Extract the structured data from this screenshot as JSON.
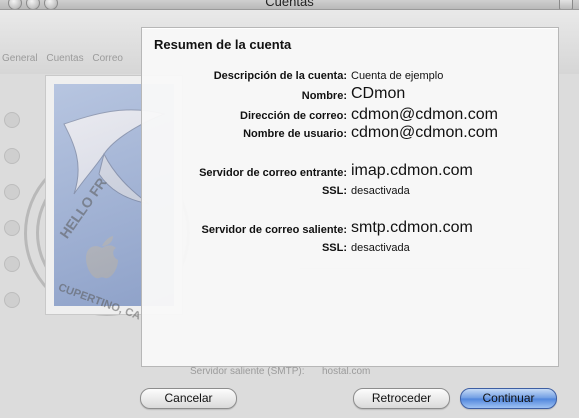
{
  "window": {
    "title": "Cuentas"
  },
  "background": {
    "toolbar_items": [
      "General",
      "Cuentas",
      "Correo"
    ],
    "ghost_fields": [
      "Servidor saliente (SMTP):",
      "hostal.com"
    ]
  },
  "stamp": {
    "text": "HELLO FROM CUPERTINO, CA"
  },
  "summary": {
    "title": "Resumen de la cuenta",
    "rows": [
      {
        "label": "Descripción de la cuenta:",
        "value": "Cuenta de ejemplo"
      },
      {
        "label": "Nombre:",
        "value": "CDmon"
      },
      {
        "label": "Dirección de correo:",
        "value": "cdmon@cdmon.com"
      },
      {
        "label": "Nombre de usuario:",
        "value": "cdmon@cdmon.com"
      },
      {
        "label": "Servidor de correo entrante:",
        "value": "imap.cdmon.com"
      },
      {
        "label": "SSL:",
        "value": "desactivada"
      },
      {
        "label": "Servidor de correo saliente:",
        "value": "smtp.cdmon.com"
      },
      {
        "label": "SSL:",
        "value": "desactivada"
      }
    ]
  },
  "buttons": {
    "cancel": "Cancelar",
    "back": "Retroceder",
    "continue": "Continuar"
  }
}
